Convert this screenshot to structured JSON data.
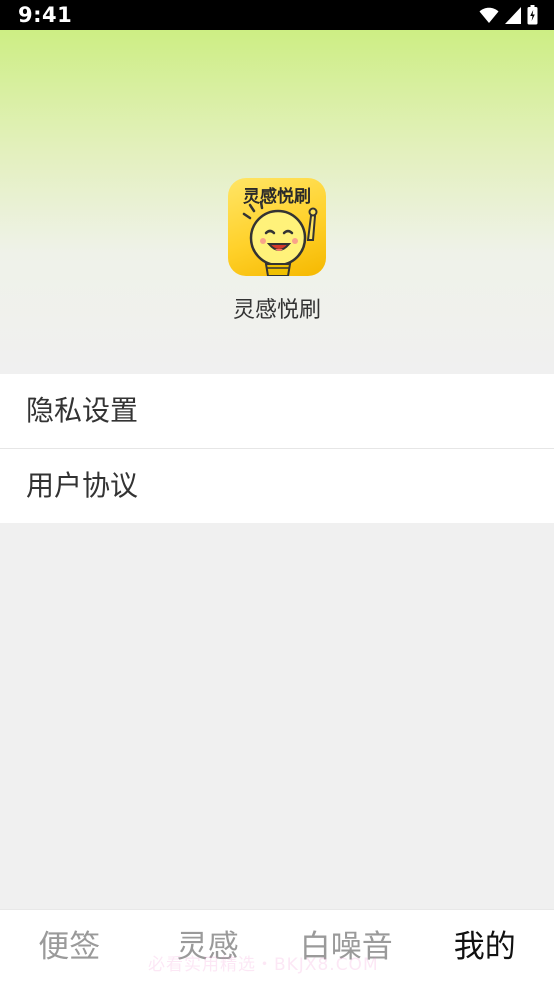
{
  "status_bar": {
    "time": "9:41",
    "icons": [
      "wifi-icon",
      "signal-icon",
      "battery-icon"
    ]
  },
  "header": {
    "app_icon_text": "灵感悦刷",
    "app_name": "灵感悦刷",
    "gradient_top": "#cdee84",
    "gradient_bottom": "#f0f0f0"
  },
  "menu": {
    "items": [
      {
        "label": "隐私设置"
      },
      {
        "label": "用户协议"
      }
    ]
  },
  "bottom_nav": {
    "items": [
      {
        "label": "便签",
        "active": false
      },
      {
        "label": "灵感",
        "active": false
      },
      {
        "label": "白噪音",
        "active": false
      },
      {
        "label": "我的",
        "active": true
      }
    ]
  },
  "watermark": "必看实用精选・BKJX8.COM",
  "colors": {
    "active_tab": "#111111",
    "inactive_tab": "#9a9a9a",
    "icon_yellow": "#ffd12a"
  }
}
